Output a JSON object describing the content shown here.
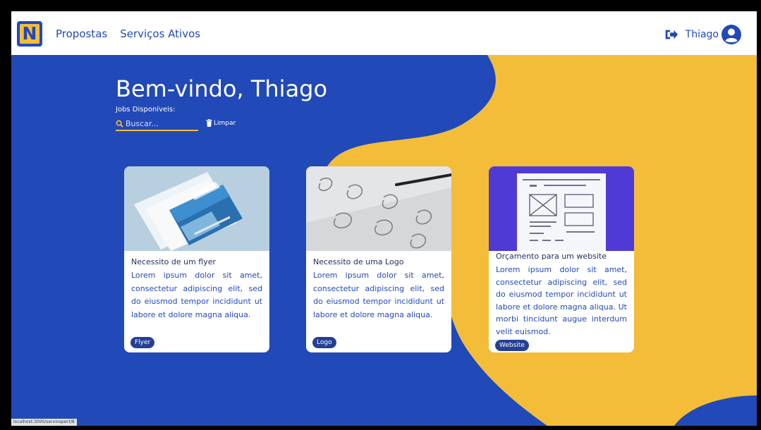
{
  "header": {
    "logo_letter": "N",
    "nav": [
      "Propostas",
      "Serviços Ativos"
    ],
    "user_name": "Thiago"
  },
  "hero": {
    "title": "Bem-vindo, Thiago",
    "subtitle": "Jobs Disponíveis:",
    "search_placeholder": "Buscar...",
    "clear_label": "Limpar"
  },
  "cards": [
    {
      "title": "Necessito de um flyer",
      "description": "Lorem ipsum dolor sit amet, consectetur adipiscing elit, sed do eiusmod tempor incididunt ut labore et dolore magna aliqua.",
      "tag": "Flyer"
    },
    {
      "title": "Necessito de uma Logo",
      "description": "Lorem ipsum dolor sit amet, consectetur adipiscing elit, sed do eiusmod tempor incididunt ut labore et dolore magna aliqua.",
      "tag": "Logo"
    },
    {
      "title": "Orçamento para um website",
      "description": "Lorem ipsum dolor sit amet, consectetur adipiscing elit, sed do eiusmod tempor incididunt ut labore et dolore magna aliqua. Ut morbi tincidunt augue interdum velit euismod.",
      "tag": "Website"
    }
  ],
  "status_bar_url": "localhost:3000/servinspect/8",
  "colors": {
    "primary_blue": "#2149b7",
    "accent_yellow": "#f3bd3a",
    "badge_blue": "#243f95"
  },
  "icons": {
    "logout": "sign-out-icon",
    "avatar": "user-circle-icon",
    "search": "magnifier-icon",
    "clear": "trash-icon"
  }
}
